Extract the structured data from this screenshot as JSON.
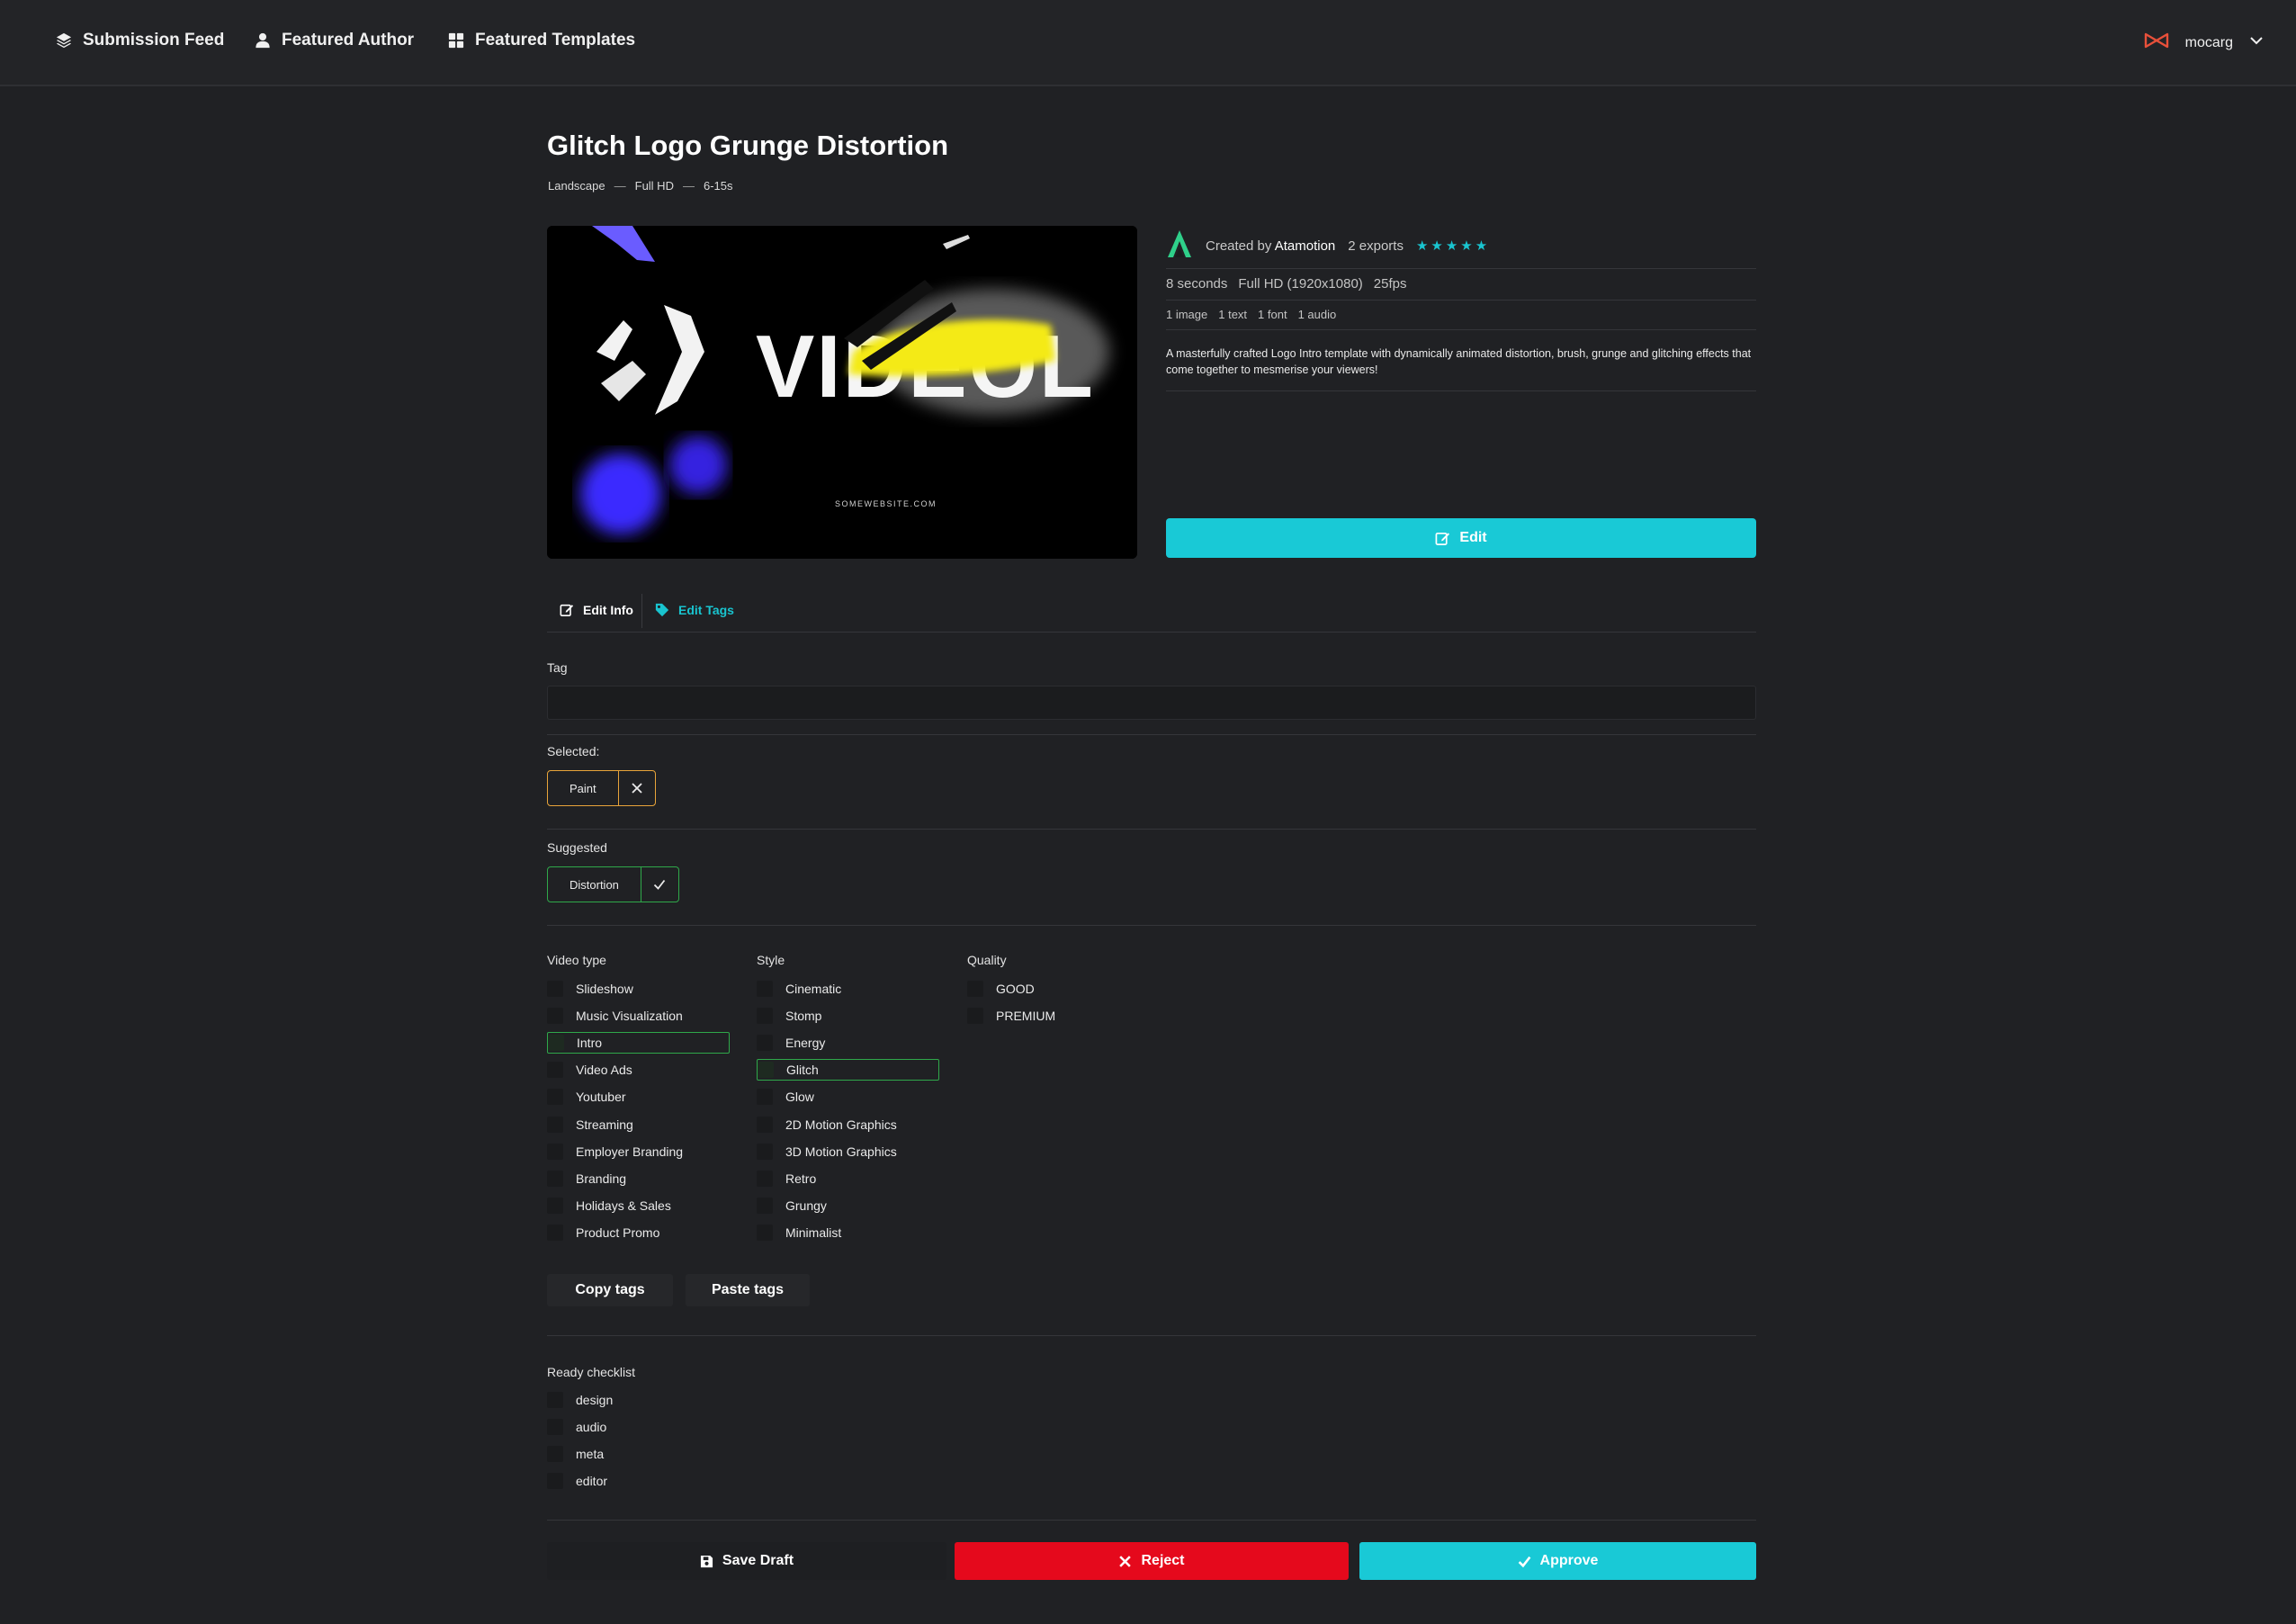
{
  "nav": {
    "items": [
      {
        "label": "Submission Feed",
        "icon": "layers-icon"
      },
      {
        "label": "Featured Author",
        "icon": "user-icon"
      },
      {
        "label": "Featured Templates",
        "icon": "grid-icon"
      }
    ],
    "username": "mocarg"
  },
  "template": {
    "title": "Glitch Logo Grunge Distortion",
    "meta": [
      "Landscape",
      "Full HD",
      "6-15s"
    ],
    "meta_separator": "—",
    "preview_text": "VIDEOL",
    "preview_url_text": "SOMEWEBSITE.COM"
  },
  "info": {
    "created_by_label": "Created by",
    "author": "Atamotion",
    "exports": "2 exports",
    "stars": "★★★★★",
    "rating": 5,
    "duration": "8 seconds",
    "resolution": "Full HD (1920x1080)",
    "fps": "25fps",
    "counts": [
      "1 image",
      "1 text",
      "1 font",
      "1 audio"
    ],
    "description": "A masterfully crafted Logo Intro template with dynamically animated distortion, brush, grunge and glitching effects that come together to mesmerise your viewers!",
    "edit_label": "Edit"
  },
  "tabs": {
    "edit_info": "Edit Info",
    "edit_tags": "Edit Tags"
  },
  "tags": {
    "tag_label": "Tag",
    "tag_value": "",
    "selected_label": "Selected:",
    "selected": [
      "Paint"
    ],
    "suggested_label": "Suggested",
    "suggested": [
      "Distortion"
    ]
  },
  "video_type": {
    "title": "Video type",
    "options": [
      "Slideshow",
      "Music Visualization",
      "Intro",
      "Video Ads",
      "Youtuber",
      "Streaming",
      "Employer Branding",
      "Branding",
      "Holidays & Sales",
      "Product Promo"
    ],
    "checked": [
      "Intro"
    ]
  },
  "style": {
    "title": "Style",
    "options": [
      "Cinematic",
      "Stomp",
      "Energy",
      "Glitch",
      "Glow",
      "2D Motion Graphics",
      "3D Motion Graphics",
      "Retro",
      "Grungy",
      "Minimalist"
    ],
    "checked": [
      "Glitch"
    ]
  },
  "quality": {
    "title": "Quality",
    "options": [
      "GOOD",
      "PREMIUM"
    ],
    "checked": []
  },
  "tools": {
    "copy": "Copy tags",
    "paste": "Paste tags"
  },
  "checklist": {
    "title": "Ready checklist",
    "items": [
      "design",
      "audio",
      "meta",
      "editor"
    ]
  },
  "actions": {
    "save": "Save Draft",
    "reject": "Reject",
    "approve": "Approve"
  },
  "colors": {
    "accent": "#19c9d6",
    "reject": "#e5091c",
    "selected_border": "#e8a43a",
    "suggested_border": "#2fa84a",
    "background": "#202124"
  }
}
